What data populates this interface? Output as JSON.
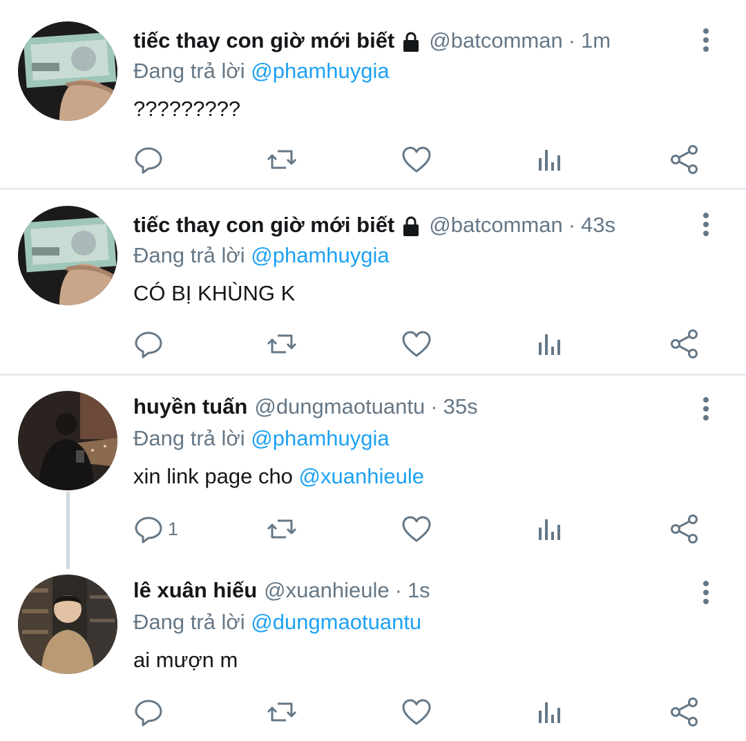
{
  "colors": {
    "accent": "#1da1f2",
    "muted": "#657786",
    "text": "#14171a",
    "divider": "#e6ecf0"
  },
  "tweets": [
    {
      "name": "tiếc thay con giờ mới biết",
      "locked": true,
      "handle": "@batcomman",
      "time": "1m",
      "reply_prefix": "Đang trả lời",
      "reply_to": "@phamhuygia",
      "text": "?????????",
      "text_mention": "",
      "reply_count": "",
      "avatar_icon": "banknote-photo"
    },
    {
      "name": "tiếc thay con giờ mới biết",
      "locked": true,
      "handle": "@batcomman",
      "time": "43s",
      "reply_prefix": "Đang trả lời",
      "reply_to": "@phamhuygia",
      "text": "CÓ BỊ KHÙNG K",
      "text_mention": "",
      "reply_count": "",
      "avatar_icon": "banknote-photo"
    },
    {
      "name": "huyền tuấn",
      "locked": false,
      "handle": "@dungmaotuantu",
      "time": "35s",
      "reply_prefix": "Đang trả lời",
      "reply_to": "@phamhuygia",
      "text": "xin link page cho ",
      "text_mention": "@xuanhieule",
      "reply_count": "1",
      "avatar_icon": "person-photo"
    },
    {
      "name": "lê xuân hiếu",
      "locked": false,
      "handle": "@xuanhieule",
      "time": "1s",
      "reply_prefix": "Đang trả lời",
      "reply_to": "@dungmaotuantu",
      "text": "ai mượn m",
      "text_mention": "",
      "reply_count": "",
      "avatar_icon": "person-photo"
    }
  ],
  "action_icons": [
    "reply-icon",
    "retweet-icon",
    "like-icon",
    "analytics-icon",
    "share-icon"
  ]
}
